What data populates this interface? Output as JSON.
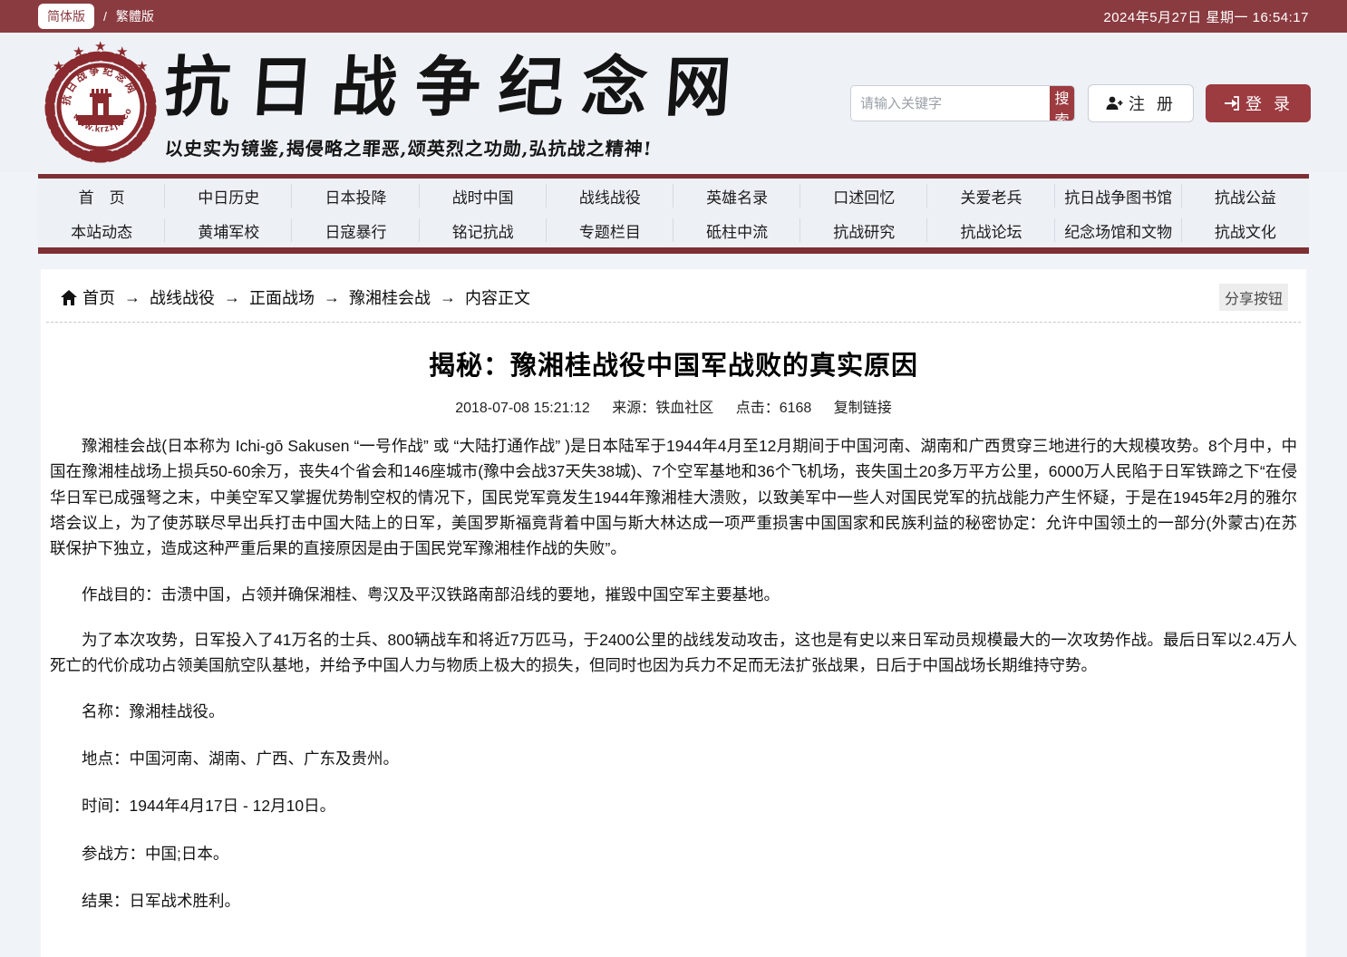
{
  "theme": {
    "maroon_dark": "#7c3034",
    "maroon": "#8a3b40",
    "maroon_button": "#9c3b40",
    "header_bg": "#eef1f6",
    "page_bg": "#f0f3f7"
  },
  "topbar": {
    "lang_simplified": "简体版",
    "lang_separator": "/",
    "lang_traditional": "繁體版",
    "datetime": "2024年5月27日 星期一 16:54:17"
  },
  "header": {
    "site_title": "抗日战争纪念网",
    "slogan": "以史实为镜鉴,揭侵略之罪恶,颂英烈之功勋,弘抗战之精神!",
    "logo": {
      "emblem_top_text": "抗日战争纪念网",
      "emblem_bottom_text": "www.krzzjn.com",
      "star_icon": "★"
    },
    "search": {
      "placeholder": "请输入关键字",
      "button_label": "搜索"
    },
    "register_label": "注 册",
    "login_label": "登 录"
  },
  "nav": {
    "row1": [
      "首　页",
      "中日历史",
      "日本投降",
      "战时中国",
      "战线战役",
      "英雄名录",
      "口述回忆",
      "关爱老兵",
      "抗日战争图书馆",
      "抗战公益"
    ],
    "row2": [
      "本站动态",
      "黄埔军校",
      "日寇暴行",
      "铭记抗战",
      "专题栏目",
      "砥柱中流",
      "抗战研究",
      "抗战论坛",
      "纪念场馆和文物",
      "抗战文化"
    ]
  },
  "breadcrumb": {
    "items": [
      "首页",
      "战线战役",
      "正面战场",
      "豫湘桂会战",
      "内容正文"
    ],
    "separator": "→",
    "share_label": "分享按钮"
  },
  "article": {
    "title": "揭秘：豫湘桂战役中国军战败的真实原因",
    "meta": {
      "datetime": "2018-07-08 15:21:12",
      "source": "来源：铁血社区",
      "hits": "点击：6168",
      "copy_link": "复制链接"
    },
    "paragraphs": [
      "豫湘桂会战(日本称为 Ichi-gō Sakusen “一号作战” 或 “大陆打通作战” )是日本陆军于1944年4月至12月期间于中国河南、湖南和广西贯穿三地进行的大规模攻势。8个月中，中国在豫湘桂战场上损兵50-60余万，丧失4个省会和146座城市(豫中会战37天失38城)、7个空军基地和36个飞机场，丧失国土20多万平方公里，6000万人民陷于日军铁蹄之下“在侵华日军已成强弩之末，中美空军又掌握优势制空权的情况下，国民党军竟发生1944年豫湘桂大溃败，以致美军中一些人对国民党军的抗战能力产生怀疑，于是在1945年2月的雅尔塔会议上，为了使苏联尽早出兵打击中国大陆上的日军，美国罗斯福竟背着中国与斯大林达成一项严重损害中国国家和民族利益的秘密协定：允许中国领土的一部分(外蒙古)在苏联保护下独立，造成这种严重后果的直接原因是由于国民党军豫湘桂作战的失败”。",
      "作战目的：击溃中国，占领并确保湘桂、粤汉及平汉铁路南部沿线的要地，摧毁中国空军主要基地。",
      "为了本次攻势，日军投入了41万名的士兵、800辆战车和将近7万匹马，于2400公里的战线发动攻击，这也是有史以来日军动员规模最大的一次攻势作战。最后日军以2.4万人死亡的代价成功占领美国航空队基地，并给予中国人力与物质上极大的损失，但同时也因为兵力不足而无法扩张战果，日后于中国战场长期维持守势。",
      "名称：豫湘桂战役。",
      "地点：中国河南、湖南、广西、广东及贵州。",
      "时间：1944年4月17日 - 12月10日。",
      "参战方：中国;日本。",
      "结果：日军战术胜利。"
    ]
  }
}
